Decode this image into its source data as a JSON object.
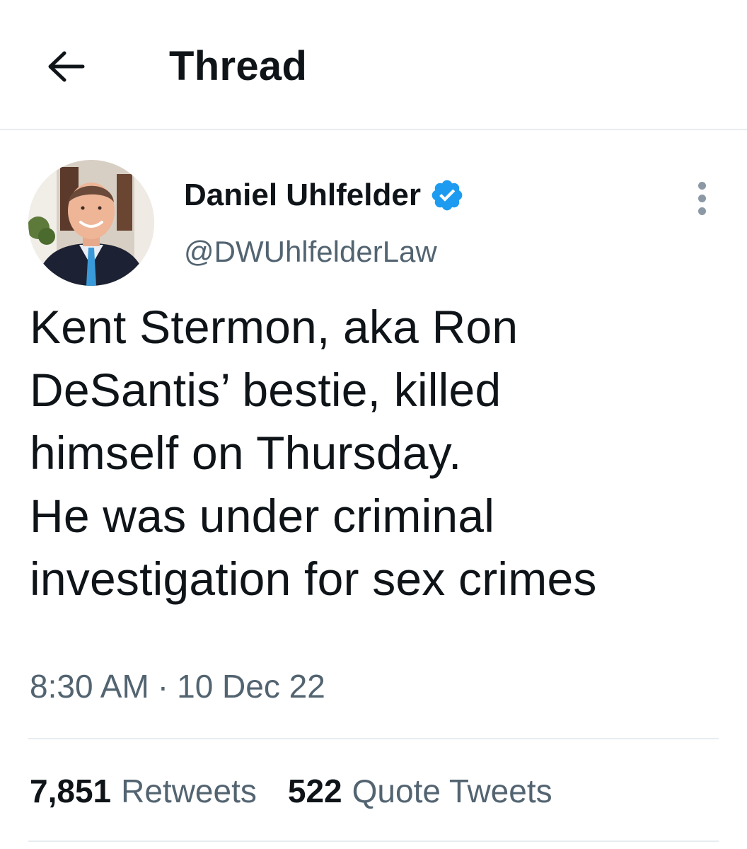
{
  "header": {
    "back_icon": "arrow-left-icon",
    "title": "Thread"
  },
  "tweet": {
    "author_name": "Daniel Uhlfelder",
    "verified_icon": "verified-badge-icon",
    "handle": "@DWUhlfelderLaw",
    "more_icon": "more-dots-icon",
    "text": "Kent Stermon, aka Ron\nDeSantis’ bestie, killed\nhimself on Thursday.\nHe was under criminal\ninvestigation for sex crimes",
    "time": "8:30 AM",
    "separator": "·",
    "date": "10 Dec 22"
  },
  "stats": {
    "retweets_count": "7,851",
    "retweets_label": "Retweets",
    "quotes_count": "522",
    "quotes_label": "Quote Tweets"
  },
  "colors": {
    "text_primary": "#0f1419",
    "text_secondary": "#536471",
    "verified_blue": "#1d9bf0",
    "divider": "#e7ecf0"
  }
}
